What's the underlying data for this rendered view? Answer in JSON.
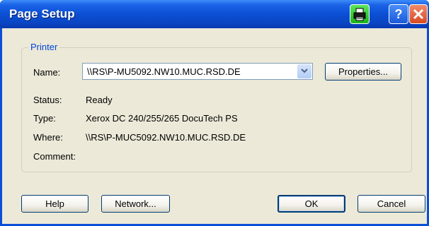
{
  "window": {
    "title": "Page Setup",
    "help_glyph": "?"
  },
  "printer_group": {
    "label": "Printer",
    "name_label": "Name:",
    "name_value": "\\\\RS\\P-MU5092.NW10.MUC.RSD.DE",
    "properties_button": "Properties...",
    "status_label": "Status:",
    "status_value": "Ready",
    "type_label": "Type:",
    "type_value": "Xerox DC 240/255/265 DocuTech PS",
    "where_label": "Where:",
    "where_value": "\\\\RS\\P-MUC5092.NW10.MUC.RSD.DE",
    "comment_label": "Comment:",
    "comment_value": ""
  },
  "buttons": {
    "help": "Help",
    "network": "Network...",
    "ok": "OK",
    "cancel": "Cancel"
  },
  "icons": {
    "printer": "printer-icon",
    "help": "help-icon",
    "close": "close-icon",
    "dropdown": "chevron-down-icon"
  },
  "colors": {
    "titlebar": "#0b4fd4",
    "group_label": "#0046d5",
    "dialog_bg": "#ece9d8"
  }
}
